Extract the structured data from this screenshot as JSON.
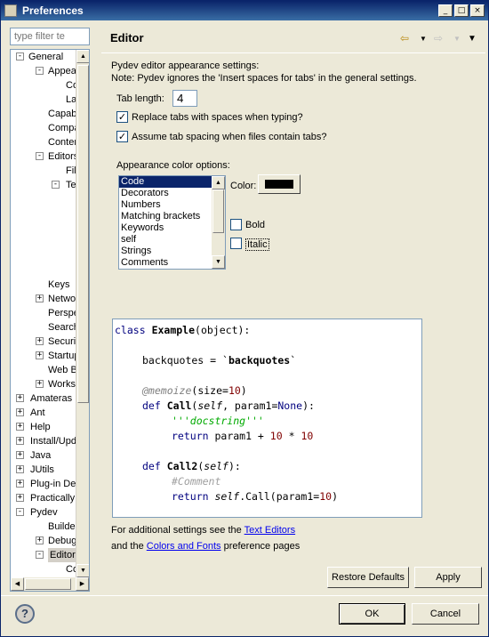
{
  "window": {
    "title": "Preferences"
  },
  "filter": {
    "placeholder": "type filter te"
  },
  "tree": [
    {
      "label": "General"
    },
    {
      "label": "Appea"
    },
    {
      "label": "Co"
    },
    {
      "label": "Lal"
    },
    {
      "label": "Capab"
    },
    {
      "label": "Compa"
    },
    {
      "label": "Conter"
    },
    {
      "label": "Editors"
    },
    {
      "label": "File"
    },
    {
      "label": "Te"
    },
    {
      "label": "Keys"
    },
    {
      "label": "Netwo"
    },
    {
      "label": "Perspe"
    },
    {
      "label": "Search"
    },
    {
      "label": "Securit"
    },
    {
      "label": "Startup"
    },
    {
      "label": "Web B"
    },
    {
      "label": "Worksp"
    },
    {
      "label": "Amateras"
    },
    {
      "label": "Ant"
    },
    {
      "label": "Help"
    },
    {
      "label": "Install/Upd"
    },
    {
      "label": "Java"
    },
    {
      "label": "JUtils"
    },
    {
      "label": "Plug-in Dev"
    },
    {
      "label": "Practically"
    },
    {
      "label": "Pydev"
    },
    {
      "label": "Builder"
    },
    {
      "label": "Debug"
    },
    {
      "label": "Editor"
    },
    {
      "label": "Co"
    }
  ],
  "page": {
    "title": "Editor",
    "description1": "Pydev editor appearance settings:",
    "description2": "Note: Pydev ignores the 'Insert spaces for tabs' in the general settings.",
    "tab_length_label": "Tab length:",
    "tab_length_value": "4",
    "replace_tabs_label": "Replace tabs with spaces when typing?",
    "replace_tabs_checked": true,
    "assume_tab_label": "Assume tab spacing when files contain tabs?",
    "assume_tab_checked": true,
    "appearance_label": "Appearance color options:",
    "color_options": [
      "Code",
      "Decorators",
      "Numbers",
      "Matching brackets",
      "Keywords",
      "self",
      "Strings",
      "Comments"
    ],
    "selected_color_option": "Code",
    "color_label": "Color:",
    "current_color": "#000000",
    "bold_label": "Bold",
    "bold_checked": false,
    "italic_label": "Italic",
    "italic_checked": false
  },
  "preview": {
    "l1_kw": "class",
    "l1_name": "Example",
    "l1_rest": "(object):",
    "l2_a": "backquotes = `",
    "l2_b": "backquotes",
    "l2_c": "`",
    "l3_dec": "@memoize",
    "l3_a": "(size=",
    "l3_num": "10",
    "l3_b": ")",
    "l4_kw": "def",
    "l4_name": "Call",
    "l4_a": "(",
    "l4_self": "self",
    "l4_b": ", param1=",
    "l4_none": "None",
    "l4_c": "):",
    "l5_doc": "'''docstring'''",
    "l6_kw": "return",
    "l6_a": " param1 + ",
    "l6_n1": "10",
    "l6_b": " * ",
    "l6_n2": "10",
    "l7_kw": "def",
    "l7_name": "Call2",
    "l7_a": "(",
    "l7_self": "self",
    "l7_b": "):",
    "l8_cmt": "#Comment",
    "l9_kw": "return",
    "l9_self": "self",
    "l9_a": ".Call(param1=",
    "l9_num": "10",
    "l9_b": ")"
  },
  "footer": {
    "f1_a": "For additional settings see the ",
    "f1_link": "Text Editors",
    "f2_a": "and  the ",
    "f2_link": "Colors and Fonts",
    "f2_b": " preference pages"
  },
  "buttons": {
    "restore": "Restore Defaults",
    "apply": "Apply",
    "ok": "OK",
    "cancel": "Cancel",
    "help": "?"
  },
  "icons": {
    "back": "arrow-left-icon",
    "forward": "arrow-right-icon",
    "menu": "view-menu-icon"
  }
}
